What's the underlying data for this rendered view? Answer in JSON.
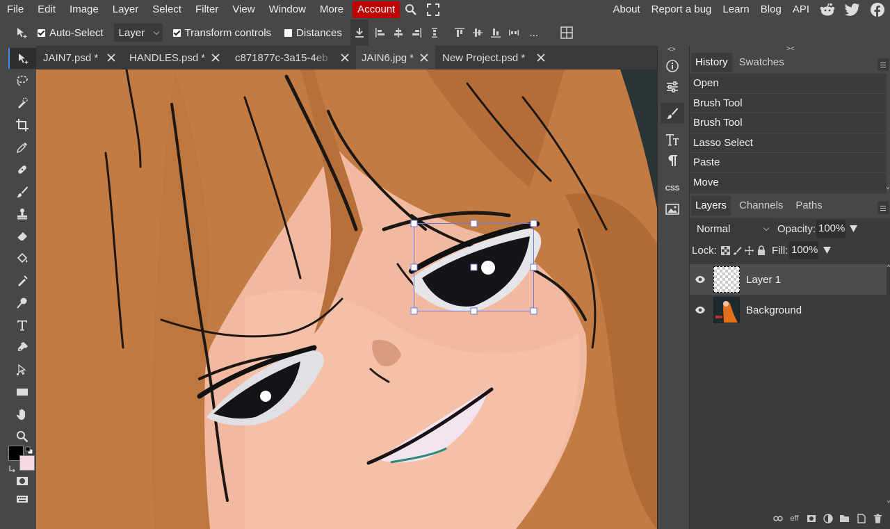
{
  "menu": {
    "items": [
      "File",
      "Edit",
      "Image",
      "Layer",
      "Select",
      "Filter",
      "View",
      "Window",
      "More",
      "Account"
    ],
    "right_links": [
      "About",
      "Report a bug",
      "Learn",
      "Blog",
      "API"
    ],
    "icons": [
      "search-icon",
      "fullscreen-icon",
      "reddit-icon",
      "twitter-icon",
      "facebook-icon"
    ],
    "account_color": "#c10000"
  },
  "options": {
    "auto_select_label": "Auto-Select",
    "auto_select_checked": true,
    "target_select": "Layer",
    "transform_label": "Transform controls",
    "transform_checked": true,
    "distances_label": "Distances",
    "distances_checked": false,
    "more": "..."
  },
  "tabs": [
    {
      "label": "JAIN7.psd *",
      "active": false
    },
    {
      "label": "HANDLES.psd *",
      "active": false
    },
    {
      "label": "c871877c-3a15-4eb",
      "active": false
    },
    {
      "label": "JAIN6.jpg *",
      "active": true
    },
    {
      "label": "New Project.psd *",
      "active": false
    }
  ],
  "colors": {
    "foreground": "#000000",
    "background": "#f6d7e3",
    "accent": "#3b8eea"
  },
  "panels": {
    "mini_css": "CSS",
    "history": {
      "tabs": [
        "History",
        "Swatches"
      ],
      "items": [
        "Open",
        "Brush Tool",
        "Brush Tool",
        "Lasso Select",
        "Paste",
        "Move"
      ]
    },
    "layers": {
      "tabs": [
        "Layers",
        "Channels",
        "Paths"
      ],
      "blend_mode": "Normal",
      "opacity_label": "Opacity:",
      "opacity_value": "100%",
      "lock_label": "Lock:",
      "fill_label": "Fill:",
      "fill_value": "100%",
      "items": [
        {
          "name": "Layer 1",
          "selected": true
        },
        {
          "name": "Background",
          "selected": false
        }
      ],
      "footer_eff": "eff"
    }
  }
}
